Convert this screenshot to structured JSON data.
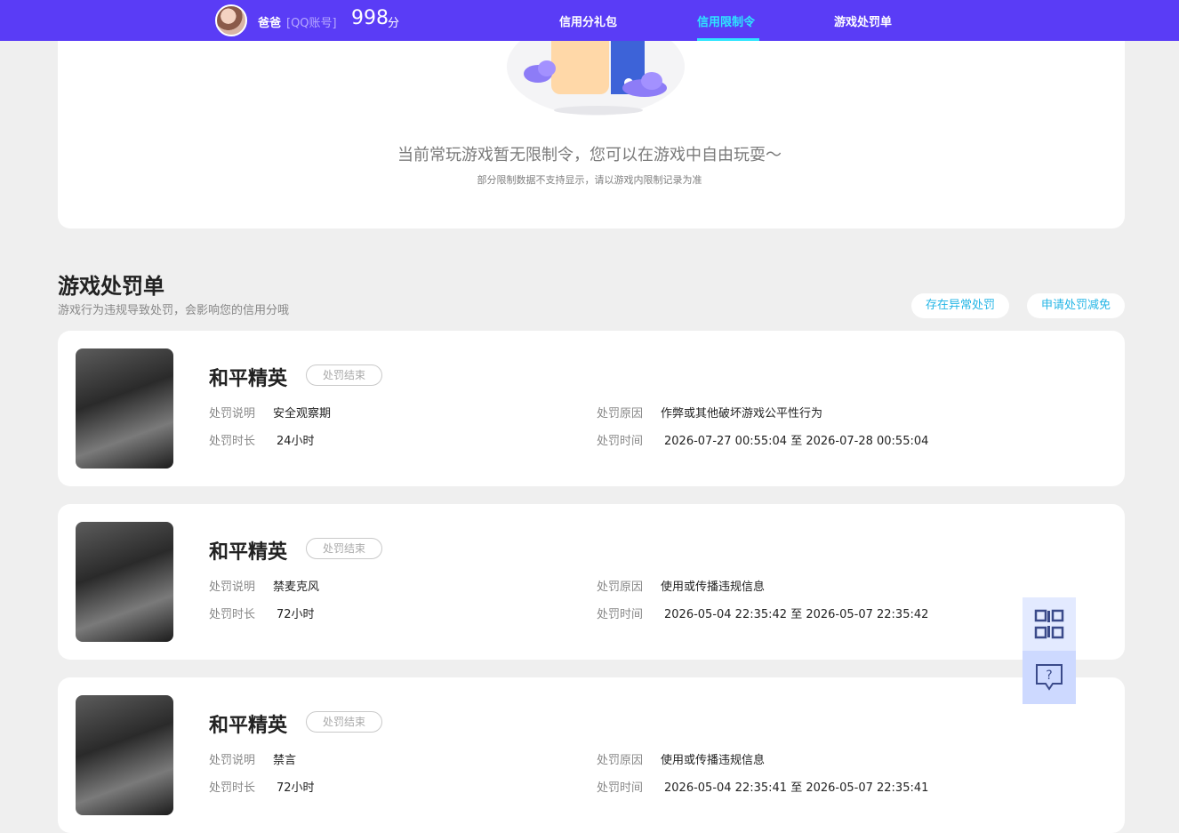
{
  "header": {
    "user_name": "爸爸",
    "account_type": "[QQ账号]",
    "score": "998",
    "score_unit": "分",
    "nav": [
      {
        "label": "信用分礼包",
        "active": false
      },
      {
        "label": "信用限制令",
        "active": true
      },
      {
        "label": "游戏处罚单",
        "active": false
      }
    ]
  },
  "restriction": {
    "title": "当前常玩游戏暂无限制令，您可以在游戏中自由玩耍～",
    "subtitle": "部分限制数据不支持显示，请以游戏内限制记录为准"
  },
  "penalty_section": {
    "title": "游戏处罚单",
    "subtitle": "游戏行为违规导致处罚，会影响您的信用分哦",
    "btn_abnormal": "存在异常处罚",
    "btn_appeal": "申请处罚减免"
  },
  "labels": {
    "desc": "处罚说明",
    "reason": "处罚原因",
    "duration": "处罚时长",
    "time": "处罚时间"
  },
  "penalties": [
    {
      "game": "和平精英",
      "status": "处罚结束",
      "desc": "安全观察期",
      "reason": "作弊或其他破坏游戏公平性行为",
      "duration": "24小时",
      "time": "2026-07-27 00:55:04 至 2026-07-28 00:55:04"
    },
    {
      "game": "和平精英",
      "status": "处罚结束",
      "desc": "禁麦克风",
      "reason": "使用或传播违规信息",
      "duration": "72小时",
      "time": "2026-05-04 22:35:42 至 2026-05-07 22:35:42"
    },
    {
      "game": "和平精英",
      "status": "处罚结束",
      "desc": "禁言",
      "reason": "使用或传播违规信息",
      "duration": "72小时",
      "time": "2026-05-04 22:35:41 至 2026-05-07 22:35:41"
    }
  ],
  "colors": {
    "topbar": "#5a3cf6",
    "active_nav": "#2ee6ff",
    "pill_text": "#26b6e6"
  },
  "icons": {
    "qr": "qr-code-icon",
    "help": "help-chat-icon"
  }
}
